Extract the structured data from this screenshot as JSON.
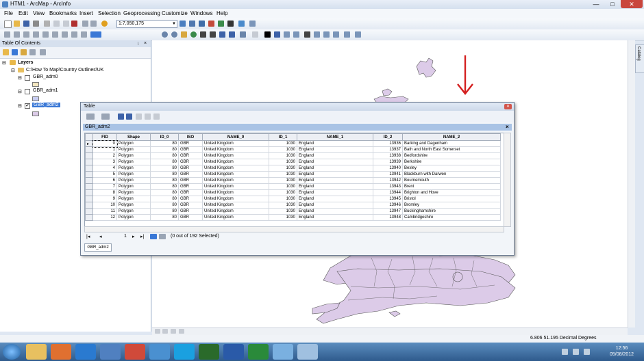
{
  "window": {
    "title": "HTM1 - ArcMap - ArcInfo"
  },
  "menu": [
    "File",
    "Edit",
    "View",
    "Bookmarks",
    "Insert",
    "Selection",
    "Geoprocessing",
    "Customize",
    "Windows",
    "Help"
  ],
  "toolbar": {
    "scale": "1:7,050,175"
  },
  "toc": {
    "title": "Table Of Contents",
    "root": "Layers",
    "folder": "C:\\How To Map\\Country Outlines\\UK",
    "layers": [
      {
        "name": "GBR_adm0",
        "checked": ""
      },
      {
        "name": "GBR_adm1",
        "checked": ""
      },
      {
        "name": "GBR_adm2",
        "checked": "✔"
      }
    ]
  },
  "catalog_tab": "Catalog",
  "table": {
    "window_title": "Table",
    "layer": "GBR_adm2",
    "columns": [
      "FID",
      "Shape",
      "ID_0",
      "ISO",
      "NAME_0",
      "ID_1",
      "NAME_1",
      "ID_2",
      "NAME_2"
    ],
    "rows": [
      [
        "0",
        "Polygon",
        "80",
        "GBR",
        "United Kingdom",
        "1030",
        "England",
        "13936",
        "Barking and Dagenham"
      ],
      [
        "1",
        "Polygon",
        "80",
        "GBR",
        "United Kingdom",
        "1030",
        "England",
        "13937",
        "Bath and North East Somerset"
      ],
      [
        "2",
        "Polygon",
        "80",
        "GBR",
        "United Kingdom",
        "1030",
        "England",
        "13938",
        "Bedfordshire"
      ],
      [
        "3",
        "Polygon",
        "80",
        "GBR",
        "United Kingdom",
        "1030",
        "England",
        "13939",
        "Berkshire"
      ],
      [
        "4",
        "Polygon",
        "80",
        "GBR",
        "United Kingdom",
        "1030",
        "England",
        "13940",
        "Bexley"
      ],
      [
        "5",
        "Polygon",
        "80",
        "GBR",
        "United Kingdom",
        "1030",
        "England",
        "13941",
        "Blackburn with Darwen"
      ],
      [
        "6",
        "Polygon",
        "80",
        "GBR",
        "United Kingdom",
        "1030",
        "England",
        "13942",
        "Bournemouth"
      ],
      [
        "7",
        "Polygon",
        "80",
        "GBR",
        "United Kingdom",
        "1030",
        "England",
        "13943",
        "Brent"
      ],
      [
        "8",
        "Polygon",
        "80",
        "GBR",
        "United Kingdom",
        "1030",
        "England",
        "13944",
        "Brighton and Hove"
      ],
      [
        "9",
        "Polygon",
        "80",
        "GBR",
        "United Kingdom",
        "1030",
        "England",
        "13945",
        "Bristol"
      ],
      [
        "10",
        "Polygon",
        "80",
        "GBR",
        "United Kingdom",
        "1030",
        "England",
        "13946",
        "Bromley"
      ],
      [
        "11",
        "Polygon",
        "80",
        "GBR",
        "United Kingdom",
        "1030",
        "England",
        "13947",
        "Buckinghamshire"
      ],
      [
        "12",
        "Polygon",
        "80",
        "GBR",
        "United Kingdom",
        "1030",
        "England",
        "13948",
        "Cambridgeshire"
      ]
    ],
    "record": "1",
    "selection": "(0 out of 192 Selected)",
    "tab": "GBR_adm2"
  },
  "status": {
    "coords": "6.806  51.195 Decimal Degrees"
  },
  "taskbar": {
    "time": "12:56",
    "date": "05/08/2012"
  },
  "colors": {
    "polygon_fill": "#dccbe8",
    "polygon_stroke": "#555555",
    "arrow": "#d42020",
    "selected_layer": "#3a78d6"
  }
}
